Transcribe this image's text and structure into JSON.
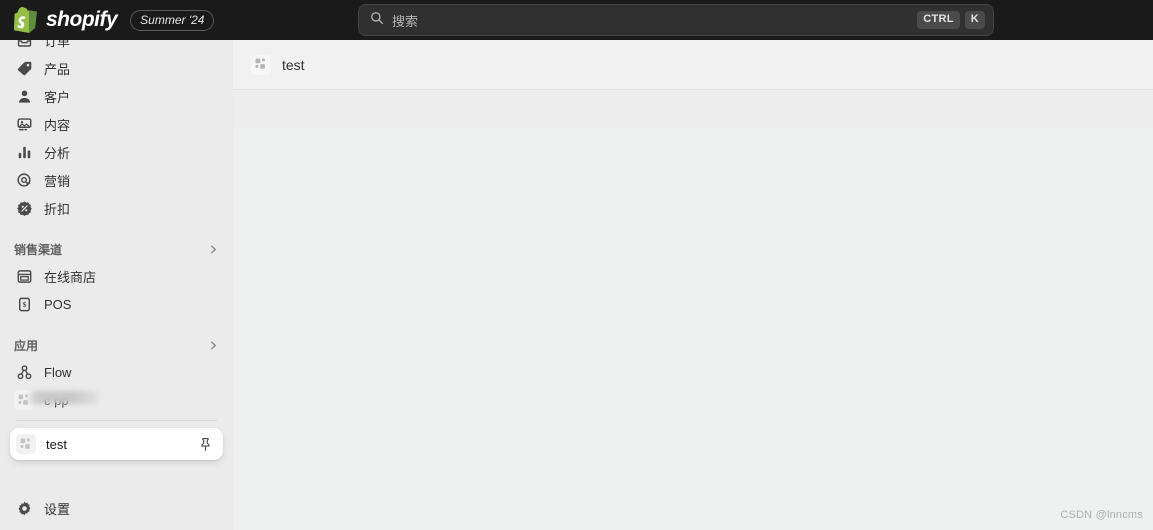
{
  "topbar": {
    "brand_name": "shopify",
    "brand_badge": "Summer '24",
    "logo_icon": "shopify-bag-icon",
    "logo_color": "#14b39e"
  },
  "search": {
    "placeholder": "搜索",
    "icon": "search-icon",
    "shortcut_keys": [
      "CTRL",
      "K"
    ]
  },
  "sidebar": {
    "nav_items": [
      {
        "label": "订单",
        "icon": "orders-inbox-icon"
      },
      {
        "label": "产品",
        "icon": "product-tag-icon"
      },
      {
        "label": "客户",
        "icon": "customer-person-icon"
      },
      {
        "label": "内容",
        "icon": "content-image-icon"
      },
      {
        "label": "分析",
        "icon": "analytics-bars-icon"
      },
      {
        "label": "营销",
        "icon": "marketing-target-icon"
      },
      {
        "label": "折扣",
        "icon": "discount-badge-icon"
      }
    ],
    "sales_channels": {
      "title": "销售渠道",
      "chevron_icon": "chevron-right-icon",
      "items": [
        {
          "label": "在线商店",
          "icon": "online-store-icon"
        },
        {
          "label": "POS",
          "icon": "pos-icon"
        }
      ]
    },
    "apps": {
      "title": "应用",
      "chevron_icon": "chevron-right-icon",
      "items": [
        {
          "label": "Flow",
          "icon": "flow-icon",
          "redacted": false
        },
        {
          "label": "c            pp",
          "icon": "app-placeholder-icon",
          "redacted": true
        }
      ]
    },
    "dragging_item": {
      "label": "test",
      "icon": "app-placeholder-icon",
      "pin_icon": "pin-icon"
    },
    "settings": {
      "label": "设置",
      "icon": "gear-icon"
    }
  },
  "main": {
    "title": "test",
    "icon": "app-placeholder-icon"
  },
  "watermark": "CSDN @lnncms"
}
